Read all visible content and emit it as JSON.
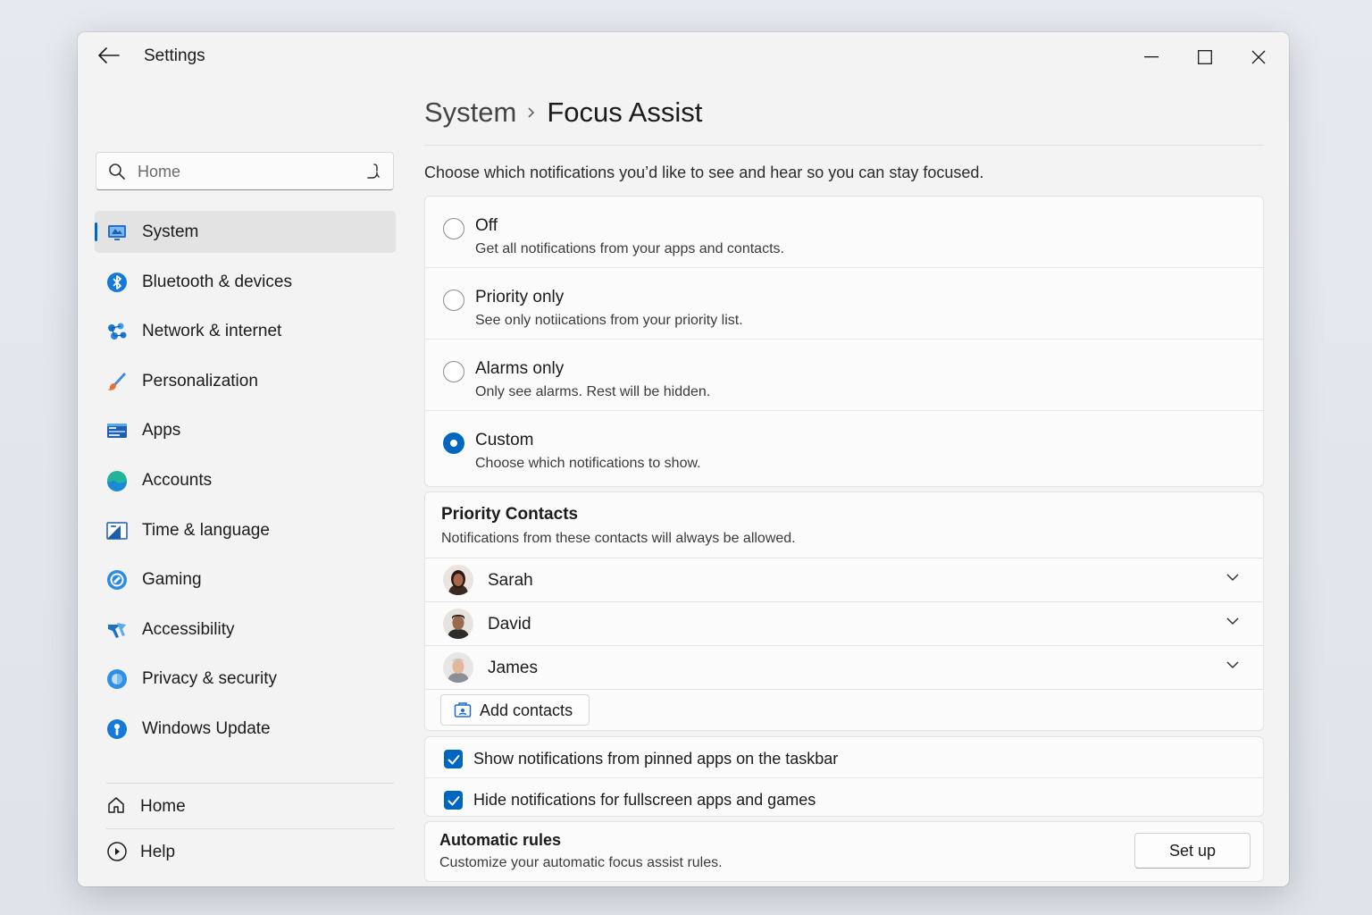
{
  "window": {
    "title": "Settings"
  },
  "search": {
    "placeholder": "Home"
  },
  "sidebar": {
    "items": [
      {
        "label": "System",
        "icon": "monitor-icon",
        "active": true
      },
      {
        "label": "Bluetooth & devices",
        "icon": "bluetooth-icon"
      },
      {
        "label": "Network & internet",
        "icon": "network-icon"
      },
      {
        "label": "Personalization",
        "icon": "brush-icon"
      },
      {
        "label": "Apps",
        "icon": "apps-icon"
      },
      {
        "label": "Accounts",
        "icon": "accounts-icon"
      },
      {
        "label": "Time & language",
        "icon": "time-language-icon"
      },
      {
        "label": "Gaming",
        "icon": "gaming-icon"
      },
      {
        "label": "Accessibility",
        "icon": "accessibility-icon"
      },
      {
        "label": "Privacy & security",
        "icon": "shield-icon"
      },
      {
        "label": "Windows Update",
        "icon": "update-icon"
      }
    ],
    "bottom": [
      {
        "label": "Home",
        "icon": "home-icon"
      },
      {
        "label": "Help",
        "icon": "help-icon"
      }
    ]
  },
  "header": {
    "parent": "System",
    "current": "Focus Assist"
  },
  "intro": "Choose which notifications you’d like to see and hear so you can stay focused.",
  "modes": [
    {
      "title": "Off",
      "description": "Get all notifications from your apps and contacts.",
      "selected": false
    },
    {
      "title": "Priority only",
      "description": "See only notiications from your priority list.",
      "selected": false
    },
    {
      "title": "Alarms only",
      "description": "Only see alarms. Rest will be hidden.",
      "selected": false
    },
    {
      "title": "Custom",
      "description": "Choose which notifications to show.",
      "selected": true
    }
  ],
  "priority_contacts": {
    "title": "Priority Contacts",
    "description": "Notifications from these contacts will always be allowed.",
    "contacts": [
      {
        "name": "Sarah"
      },
      {
        "name": "David"
      },
      {
        "name": "James"
      }
    ],
    "add_label": "Add contacts"
  },
  "options": [
    {
      "label": "Show notifications from pinned apps on the taskbar",
      "checked": true
    },
    {
      "label": "Hide notifications for fullscreen apps and games",
      "checked": true
    }
  ],
  "automatic_rules": {
    "title": "Automatic rules",
    "description": "Customize your automatic focus assist rules.",
    "button": "Set up"
  },
  "colors": {
    "accent": "#0067c0",
    "window_bg": "#f3f3f3",
    "card_bg": "#fbfbfb"
  }
}
